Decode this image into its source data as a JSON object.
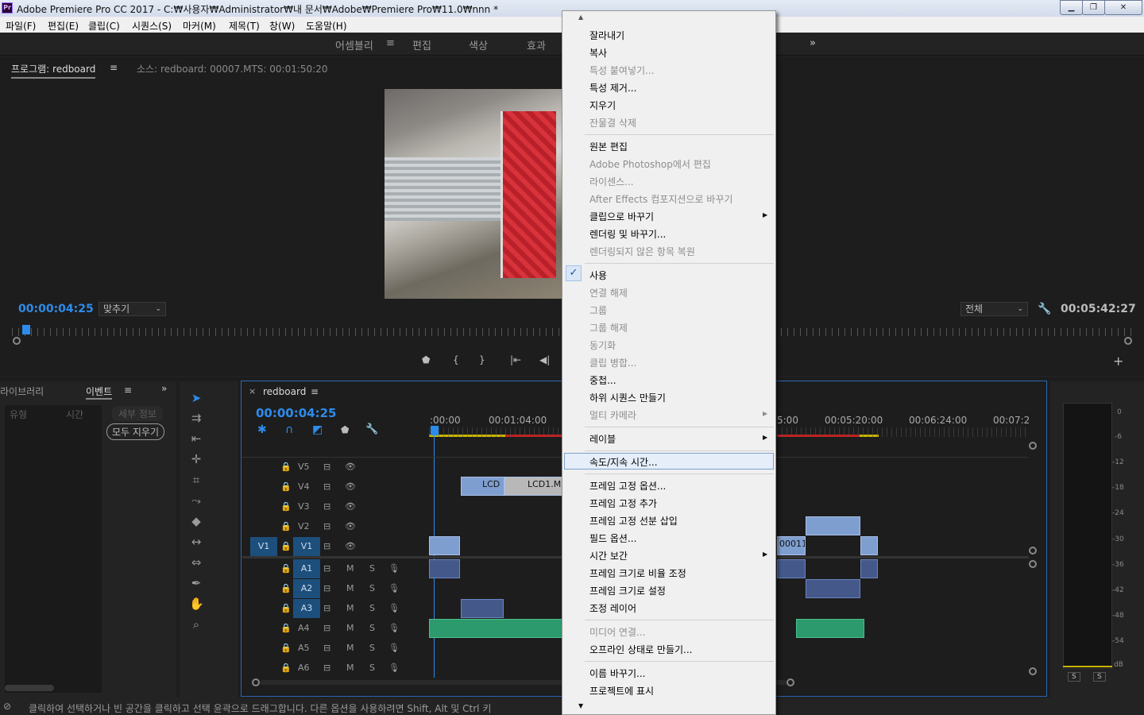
{
  "window": {
    "title": "Adobe Premiere Pro CC 2017 - C:₩사용자₩Administrator₩내 문서₩Adobe₩Premiere Pro₩11.0₩nnn *",
    "app_icon": "Pr"
  },
  "menu": [
    "파일(F)",
    "편집(E)",
    "클립(C)",
    "시퀀스(S)",
    "마커(M)",
    "제목(T)",
    "창(W)",
    "도움말(H)"
  ],
  "workspaces": {
    "items": [
      "어셈블리",
      "편집",
      "색상",
      "효과"
    ],
    "active": "어셈블리",
    "menu_glyph": "≡",
    "more": "»"
  },
  "program_monitor": {
    "tab": "프로그램: redboard",
    "tab_menu": "≡",
    "source_tab": "소스: redboard: 00007.MTS: 00:01:50:20",
    "timecode": "00:00:04:25",
    "fit": "맞추기",
    "quality": "전체",
    "duration": "00:05:42:27"
  },
  "libraries": {
    "tab": "라이브러리",
    "events_tab": "이벤트",
    "menu": "≡",
    "more": "»",
    "cols": [
      "유형",
      "시간",
      "세부 정보"
    ],
    "clear_all": "모두 지우기"
  },
  "timeline": {
    "close": "×",
    "sequence": "redboard",
    "menu": "≡",
    "timecode": "00:00:04:25",
    "ruler": [
      ":00:00",
      "00:01:04:00",
      "5:00",
      "00:05:20:00",
      "00:06:24:00",
      "00:07:2"
    ],
    "video_tracks": [
      "V5",
      "V4",
      "V3",
      "V2",
      "V1"
    ],
    "audio_tracks": [
      "A1",
      "A2",
      "A3",
      "A4",
      "A5",
      "A6"
    ],
    "source_v": "V1",
    "m": "M",
    "s": "S",
    "clips": {
      "v4a": "LCD",
      "v4b": "LCD1.M",
      "v1b": "00011"
    }
  },
  "meter": {
    "scale": [
      "0",
      "-6",
      "-12",
      "-18",
      "-24",
      "-30",
      "-36",
      "-42",
      "-48",
      "-54",
      "dB"
    ],
    "solo": [
      "S",
      "S"
    ]
  },
  "status": "클릭하여 선택하거나 빈 공간을 클릭하고 선택 윤곽으로 드래그합니다. 다른 옵션을 사용하려면 Shift, Alt 및 Ctrl 키",
  "context_menu": {
    "items": [
      {
        "label": "잘라내기",
        "disabled": false
      },
      {
        "label": "복사",
        "disabled": false
      },
      {
        "label": "특성 붙여넣기...",
        "disabled": true
      },
      {
        "label": "특성 제거...",
        "disabled": false
      },
      {
        "label": "지우기",
        "disabled": false
      },
      {
        "label": "잔물결 삭제",
        "disabled": true
      },
      {
        "label": "원본 편집",
        "disabled": false
      },
      {
        "label": "Adobe Photoshop에서 편집",
        "disabled": true
      },
      {
        "label": "라이센스...",
        "disabled": true
      },
      {
        "label": "After Effects 컴포지션으로 바꾸기",
        "disabled": true
      },
      {
        "label": "클립으로 바꾸기",
        "disabled": false
      },
      {
        "label": "렌더링 및 바꾸기...",
        "disabled": false
      },
      {
        "label": "렌더링되지 않은 항목 복원",
        "disabled": true
      },
      {
        "label": "사용",
        "disabled": false
      },
      {
        "label": "연결 해제",
        "disabled": true
      },
      {
        "label": "그룹",
        "disabled": true
      },
      {
        "label": "그룹 해제",
        "disabled": true
      },
      {
        "label": "동기화",
        "disabled": true
      },
      {
        "label": "클립 병합...",
        "disabled": true
      },
      {
        "label": "중첩...",
        "disabled": false
      },
      {
        "label": "하위 시퀀스 만들기",
        "disabled": false
      },
      {
        "label": "멀티 카메라",
        "disabled": true
      },
      {
        "label": "레이블",
        "disabled": false
      },
      {
        "label": "속도/지속 시간...",
        "disabled": false
      },
      {
        "label": "프레임 고정 옵션...",
        "disabled": false
      },
      {
        "label": "프레임 고정 추가",
        "disabled": false
      },
      {
        "label": "프레임 고정 선분 삽입",
        "disabled": false
      },
      {
        "label": "필드 옵션...",
        "disabled": false
      },
      {
        "label": "시간 보간",
        "disabled": false
      },
      {
        "label": "프레임 크기로 비율 조정",
        "disabled": false
      },
      {
        "label": "프레임 크기로 설정",
        "disabled": false
      },
      {
        "label": "조정 레이어",
        "disabled": false
      },
      {
        "label": "미디어 연결...",
        "disabled": true
      },
      {
        "label": "오프라인 상태로 만들기...",
        "disabled": false
      },
      {
        "label": "이름 바꾸기...",
        "disabled": false
      },
      {
        "label": "프로젝트에 표시",
        "disabled": false
      }
    ],
    "check": "✓",
    "submenu_arrow": "▶",
    "scroll_up": "▲",
    "scroll_down": "▼"
  }
}
